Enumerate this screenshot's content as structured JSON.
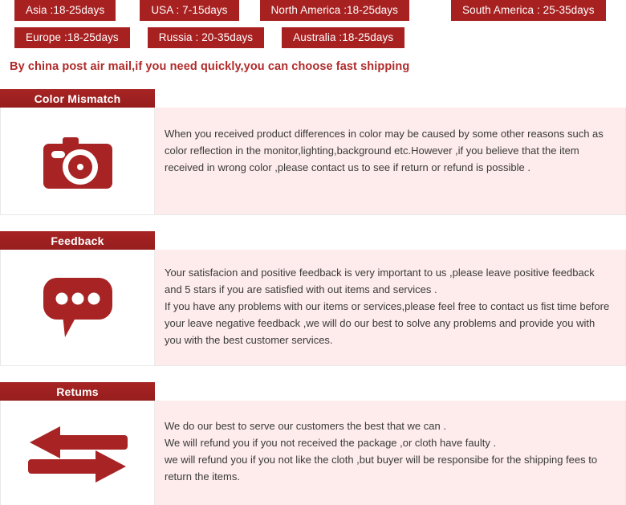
{
  "shipping_badges": {
    "row1": [
      "Asia :18-25days",
      "USA : 7-15days",
      "North America :18-25days",
      "South America : 25-35days"
    ],
    "row2": [
      "Europe :18-25days",
      "Russia : 20-35days",
      "Australia :18-25days"
    ],
    "note": "By china post air mail,if you need quickly,you can choose fast shipping",
    "badge_color": "#a82121",
    "note_color": "#b02a2a"
  },
  "sections": [
    {
      "title": "Color Mismatch",
      "icon": "camera-icon",
      "lines": [
        "When you received product differences in color may be caused by some other reasons such as color reflection in the monitor,lighting,background etc.However ,if you believe that the item received in wrong color ,please contact us to see if return or refund is possible ."
      ]
    },
    {
      "title": "Feedback",
      "icon": "speech-bubble-icon",
      "lines": [
        "Your satisfacion and positive feedback is very important to us ,please leave positive feedback and 5 stars if you are satisfied with out items and services .",
        "If you have any problems with our items or services,please feel free to contact us fist time before your leave negative feedback ,we will do our best to solve any problems and provide you with you with the best customer services."
      ]
    },
    {
      "title": "Retums",
      "icon": "exchange-arrows-icon",
      "lines": [
        "We do our best to serve our customers the best that we can .",
        "We will refund you if you not received the package ,or cloth have faulty .",
        "we will refund you if you not like the cloth ,but buyer will be responsibe for the shipping fees to return the items."
      ]
    }
  ],
  "theme": {
    "header_red": "#a02020",
    "panel_pink": "#fdeceb",
    "icon_red": "#a82424"
  }
}
